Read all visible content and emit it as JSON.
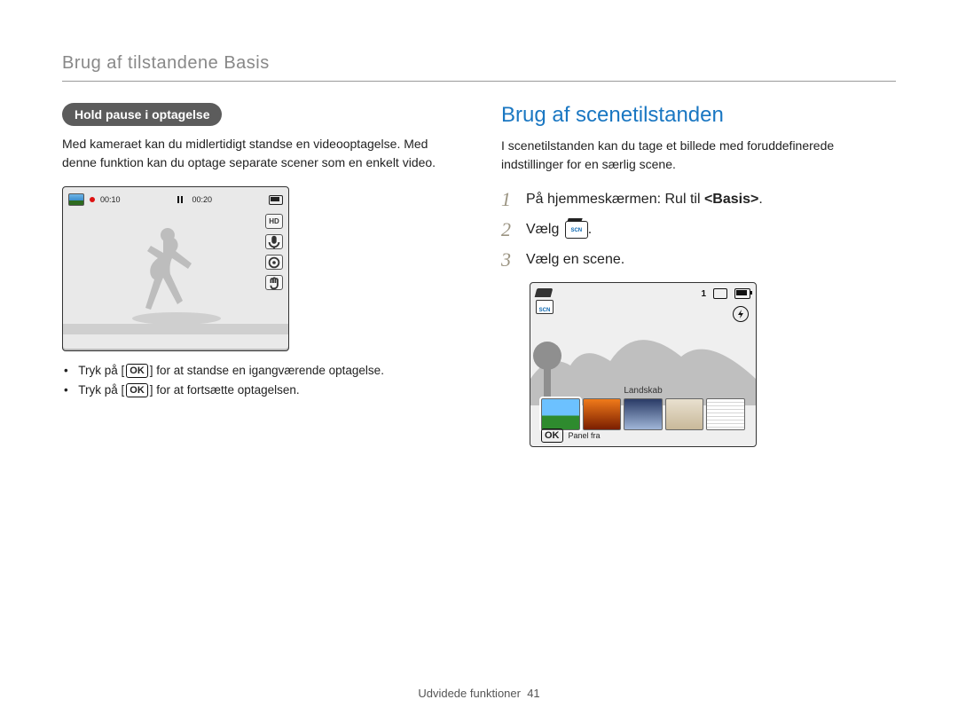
{
  "breadcrumb": "Brug af tilstandene Basis",
  "left": {
    "badge": "Hold pause i optagelse",
    "paragraph": "Med kameraet kan du midlertidigt standse en videooptagelse. Med denne funktion kan du optage separate scener som en enkelt video.",
    "rec_time": "00:10",
    "total_time": "00:20",
    "side_icons": [
      "HD",
      "mic-icon",
      "target-icon",
      "hand-icon"
    ],
    "bullet1_pre": "Tryk på [",
    "bullet1_post": "] for at standse en igangværende optagelse.",
    "bullet2_pre": "Tryk på [",
    "bullet2_post": "] for at fortsætte optagelsen.",
    "ok_label": "OK"
  },
  "right": {
    "heading": "Brug af scenetilstanden",
    "paragraph": "I scenetilstanden kan du tage et billede med foruddefinerede indstillinger for en særlig scene.",
    "step1_pre": "På hjemmeskærmen: Rul til ",
    "step1_bold": "<Basis>",
    "step1_post": ".",
    "step2": "Vælg ",
    "scn_label": "SCN",
    "step3": "Vælg en scene.",
    "overlay_count": "1",
    "scene_caption": "Landskab",
    "panel_ok": "OK",
    "panel_label": "Panel fra"
  },
  "footer": {
    "section": "Udvidede funktioner",
    "page": "41"
  }
}
